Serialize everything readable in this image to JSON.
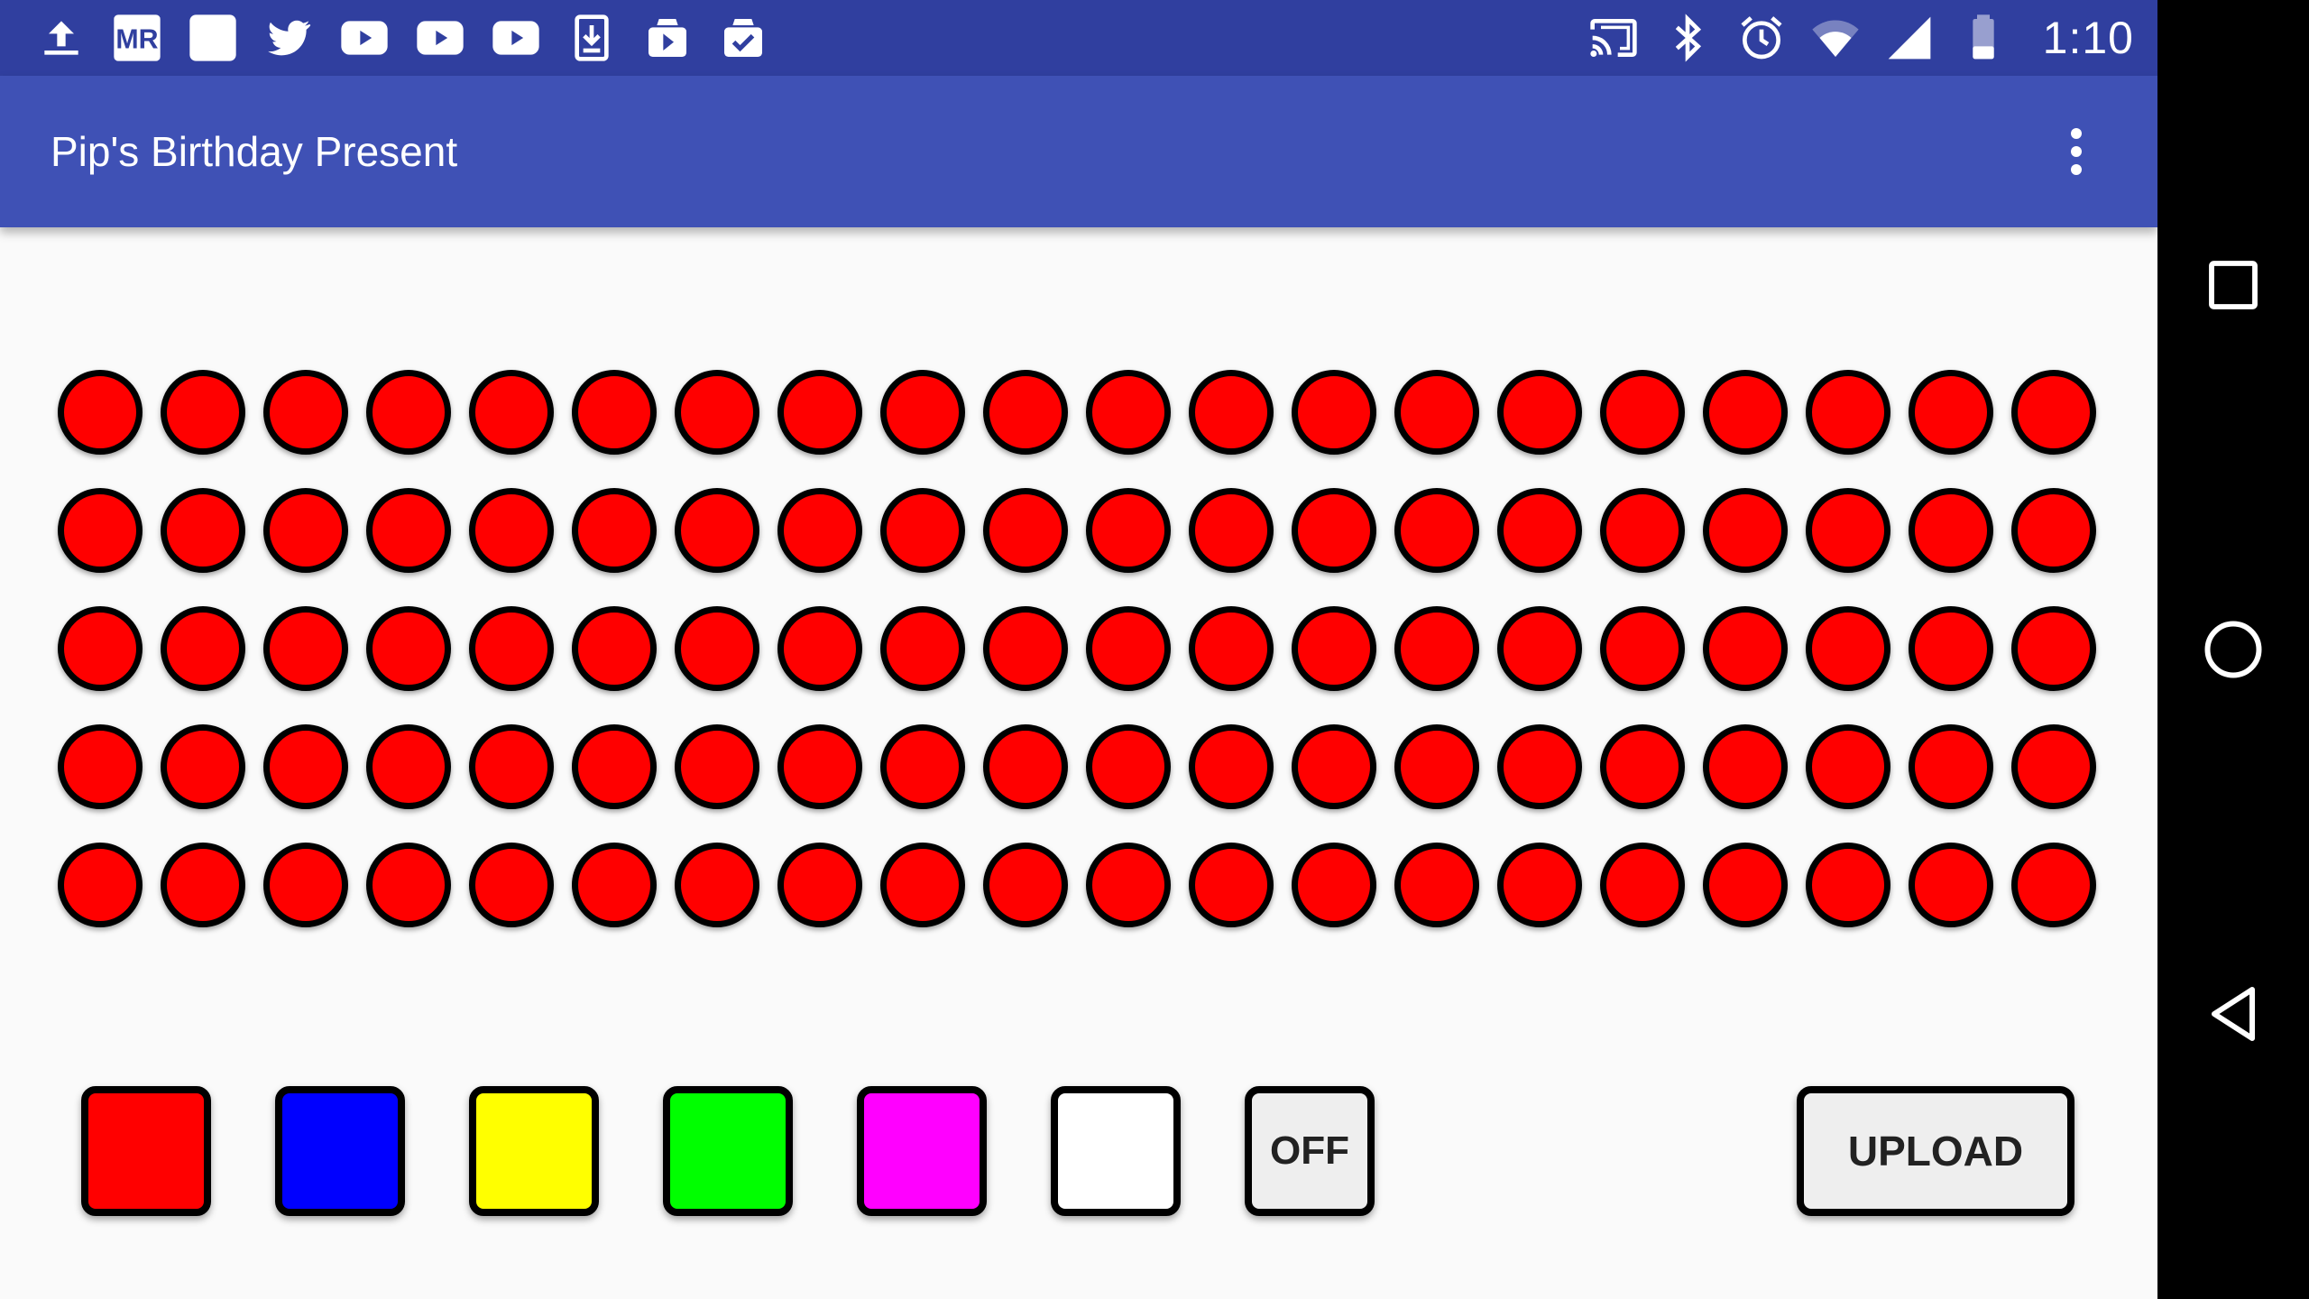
{
  "status_bar": {
    "time": "1:10",
    "notification_icons": [
      "upload-icon",
      "mr-app-icon",
      "blank-app-icon",
      "twitter-icon",
      "youtube-icon",
      "youtube-icon",
      "youtube-icon",
      "download-icon",
      "play-store-update-icon",
      "play-store-done-icon"
    ],
    "system_icons": [
      "cast-icon",
      "bluetooth-icon",
      "alarm-icon",
      "wifi-icon",
      "cell-signal-icon",
      "battery-icon"
    ],
    "mr_label": "MR"
  },
  "app_bar": {
    "title": "Pip's Birthday Present",
    "menu_icon": "overflow-menu-icon"
  },
  "led_grid": {
    "rows": 5,
    "columns": 20,
    "led_color": "#ff0000",
    "border_color": "#000000"
  },
  "color_buttons": [
    {
      "name": "red",
      "color": "#ff0000",
      "label": ""
    },
    {
      "name": "blue",
      "color": "#0000ff",
      "label": ""
    },
    {
      "name": "yellow",
      "color": "#ffff00",
      "label": ""
    },
    {
      "name": "green",
      "color": "#00ff00",
      "label": ""
    },
    {
      "name": "magenta",
      "color": "#ff00ff",
      "label": ""
    },
    {
      "name": "white",
      "color": "#ffffff",
      "label": ""
    },
    {
      "name": "off",
      "color": "#eeeeee",
      "label": "OFF"
    }
  ],
  "upload_button": {
    "label": "UPLOAD"
  },
  "nav_bar": {
    "icons": [
      "recents-square-icon",
      "home-circle-icon",
      "back-triangle-icon"
    ]
  },
  "colors": {
    "status_bar": "#303f9f",
    "app_bar": "#3f51b5",
    "background": "#fafafa"
  }
}
